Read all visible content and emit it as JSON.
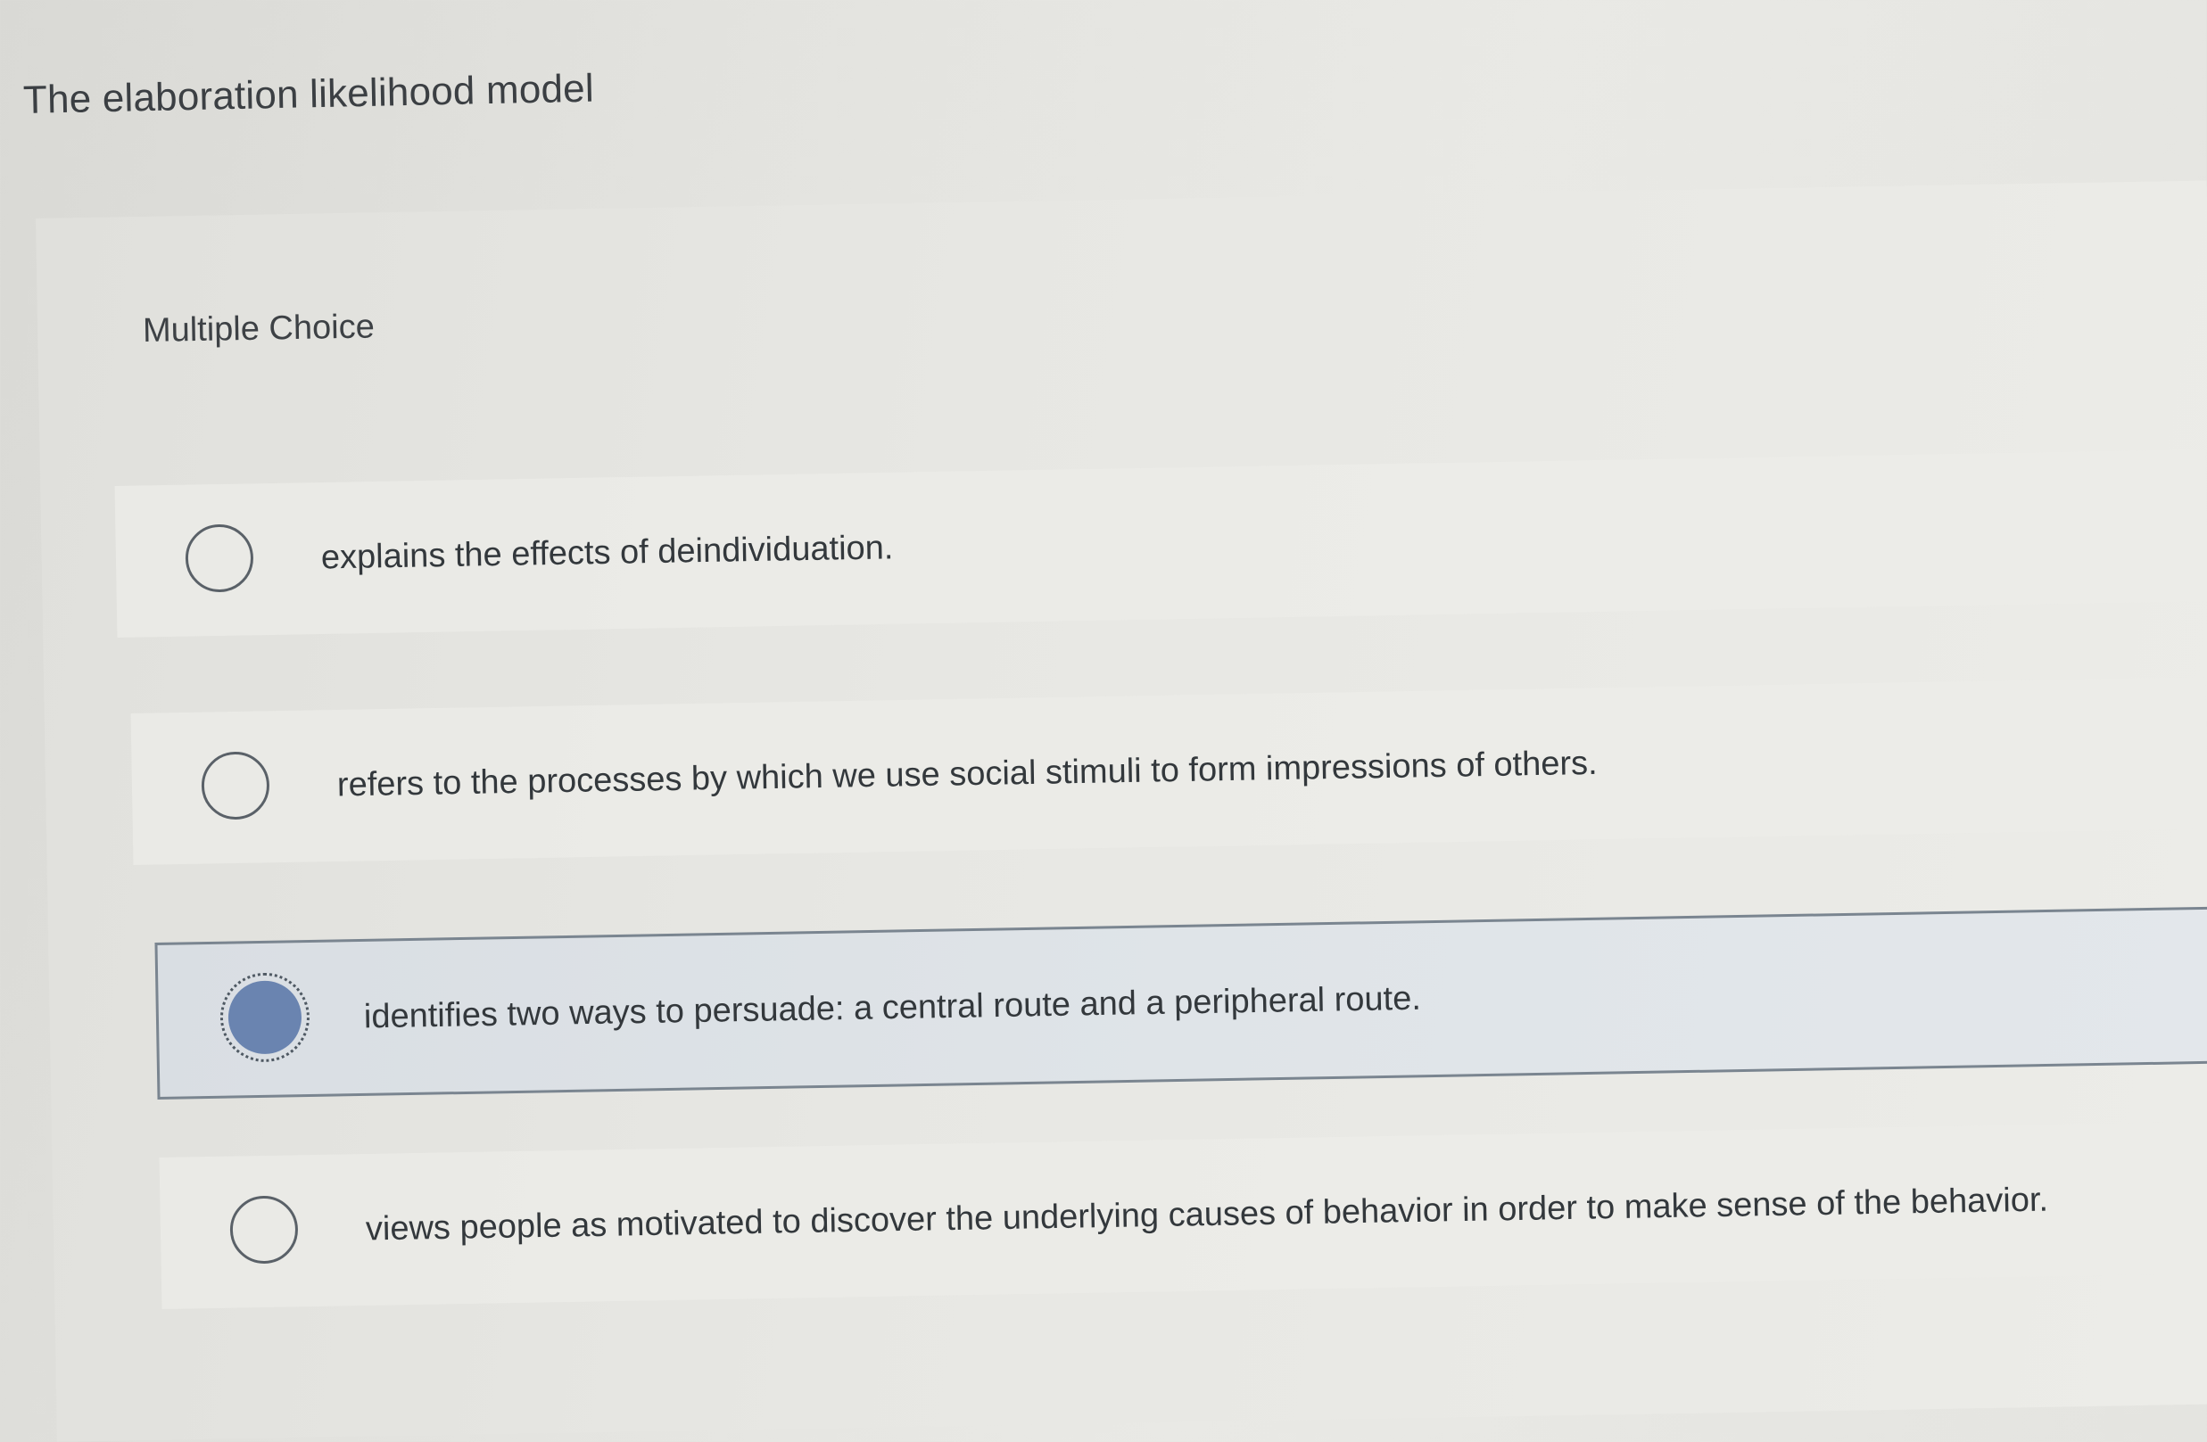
{
  "question": {
    "title": "The elaboration likelihood model",
    "type_label": "Multiple Choice"
  },
  "choices": [
    {
      "label": "explains the effects of deindividuation.",
      "selected": false
    },
    {
      "label": "refers to the processes by which we use social stimuli to form impressions of others.",
      "selected": false
    },
    {
      "label": "identifies two ways to persuade: a central route and a peripheral route.",
      "selected": true
    },
    {
      "label": "views people as motivated to discover the underlying causes of behavior in order to make sense of the behavior.",
      "selected": false
    }
  ],
  "colors": {
    "selected_radio": "#6a84b0",
    "selected_border": "#7a8590",
    "background": "#e4e4e0"
  }
}
